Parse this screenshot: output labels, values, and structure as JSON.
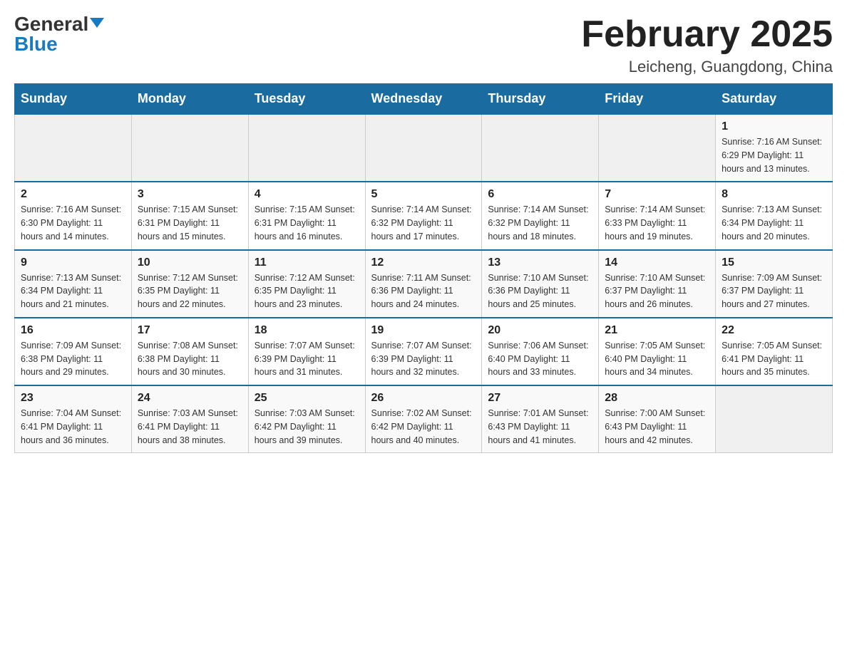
{
  "header": {
    "logo_general": "General",
    "logo_blue": "Blue",
    "month_title": "February 2025",
    "location": "Leicheng, Guangdong, China"
  },
  "days_of_week": [
    "Sunday",
    "Monday",
    "Tuesday",
    "Wednesday",
    "Thursday",
    "Friday",
    "Saturday"
  ],
  "weeks": [
    [
      {
        "day": "",
        "info": ""
      },
      {
        "day": "",
        "info": ""
      },
      {
        "day": "",
        "info": ""
      },
      {
        "day": "",
        "info": ""
      },
      {
        "day": "",
        "info": ""
      },
      {
        "day": "",
        "info": ""
      },
      {
        "day": "1",
        "info": "Sunrise: 7:16 AM\nSunset: 6:29 PM\nDaylight: 11 hours and 13 minutes."
      }
    ],
    [
      {
        "day": "2",
        "info": "Sunrise: 7:16 AM\nSunset: 6:30 PM\nDaylight: 11 hours and 14 minutes."
      },
      {
        "day": "3",
        "info": "Sunrise: 7:15 AM\nSunset: 6:31 PM\nDaylight: 11 hours and 15 minutes."
      },
      {
        "day": "4",
        "info": "Sunrise: 7:15 AM\nSunset: 6:31 PM\nDaylight: 11 hours and 16 minutes."
      },
      {
        "day": "5",
        "info": "Sunrise: 7:14 AM\nSunset: 6:32 PM\nDaylight: 11 hours and 17 minutes."
      },
      {
        "day": "6",
        "info": "Sunrise: 7:14 AM\nSunset: 6:32 PM\nDaylight: 11 hours and 18 minutes."
      },
      {
        "day": "7",
        "info": "Sunrise: 7:14 AM\nSunset: 6:33 PM\nDaylight: 11 hours and 19 minutes."
      },
      {
        "day": "8",
        "info": "Sunrise: 7:13 AM\nSunset: 6:34 PM\nDaylight: 11 hours and 20 minutes."
      }
    ],
    [
      {
        "day": "9",
        "info": "Sunrise: 7:13 AM\nSunset: 6:34 PM\nDaylight: 11 hours and 21 minutes."
      },
      {
        "day": "10",
        "info": "Sunrise: 7:12 AM\nSunset: 6:35 PM\nDaylight: 11 hours and 22 minutes."
      },
      {
        "day": "11",
        "info": "Sunrise: 7:12 AM\nSunset: 6:35 PM\nDaylight: 11 hours and 23 minutes."
      },
      {
        "day": "12",
        "info": "Sunrise: 7:11 AM\nSunset: 6:36 PM\nDaylight: 11 hours and 24 minutes."
      },
      {
        "day": "13",
        "info": "Sunrise: 7:10 AM\nSunset: 6:36 PM\nDaylight: 11 hours and 25 minutes."
      },
      {
        "day": "14",
        "info": "Sunrise: 7:10 AM\nSunset: 6:37 PM\nDaylight: 11 hours and 26 minutes."
      },
      {
        "day": "15",
        "info": "Sunrise: 7:09 AM\nSunset: 6:37 PM\nDaylight: 11 hours and 27 minutes."
      }
    ],
    [
      {
        "day": "16",
        "info": "Sunrise: 7:09 AM\nSunset: 6:38 PM\nDaylight: 11 hours and 29 minutes."
      },
      {
        "day": "17",
        "info": "Sunrise: 7:08 AM\nSunset: 6:38 PM\nDaylight: 11 hours and 30 minutes."
      },
      {
        "day": "18",
        "info": "Sunrise: 7:07 AM\nSunset: 6:39 PM\nDaylight: 11 hours and 31 minutes."
      },
      {
        "day": "19",
        "info": "Sunrise: 7:07 AM\nSunset: 6:39 PM\nDaylight: 11 hours and 32 minutes."
      },
      {
        "day": "20",
        "info": "Sunrise: 7:06 AM\nSunset: 6:40 PM\nDaylight: 11 hours and 33 minutes."
      },
      {
        "day": "21",
        "info": "Sunrise: 7:05 AM\nSunset: 6:40 PM\nDaylight: 11 hours and 34 minutes."
      },
      {
        "day": "22",
        "info": "Sunrise: 7:05 AM\nSunset: 6:41 PM\nDaylight: 11 hours and 35 minutes."
      }
    ],
    [
      {
        "day": "23",
        "info": "Sunrise: 7:04 AM\nSunset: 6:41 PM\nDaylight: 11 hours and 36 minutes."
      },
      {
        "day": "24",
        "info": "Sunrise: 7:03 AM\nSunset: 6:41 PM\nDaylight: 11 hours and 38 minutes."
      },
      {
        "day": "25",
        "info": "Sunrise: 7:03 AM\nSunset: 6:42 PM\nDaylight: 11 hours and 39 minutes."
      },
      {
        "day": "26",
        "info": "Sunrise: 7:02 AM\nSunset: 6:42 PM\nDaylight: 11 hours and 40 minutes."
      },
      {
        "day": "27",
        "info": "Sunrise: 7:01 AM\nSunset: 6:43 PM\nDaylight: 11 hours and 41 minutes."
      },
      {
        "day": "28",
        "info": "Sunrise: 7:00 AM\nSunset: 6:43 PM\nDaylight: 11 hours and 42 minutes."
      },
      {
        "day": "",
        "info": ""
      }
    ]
  ]
}
